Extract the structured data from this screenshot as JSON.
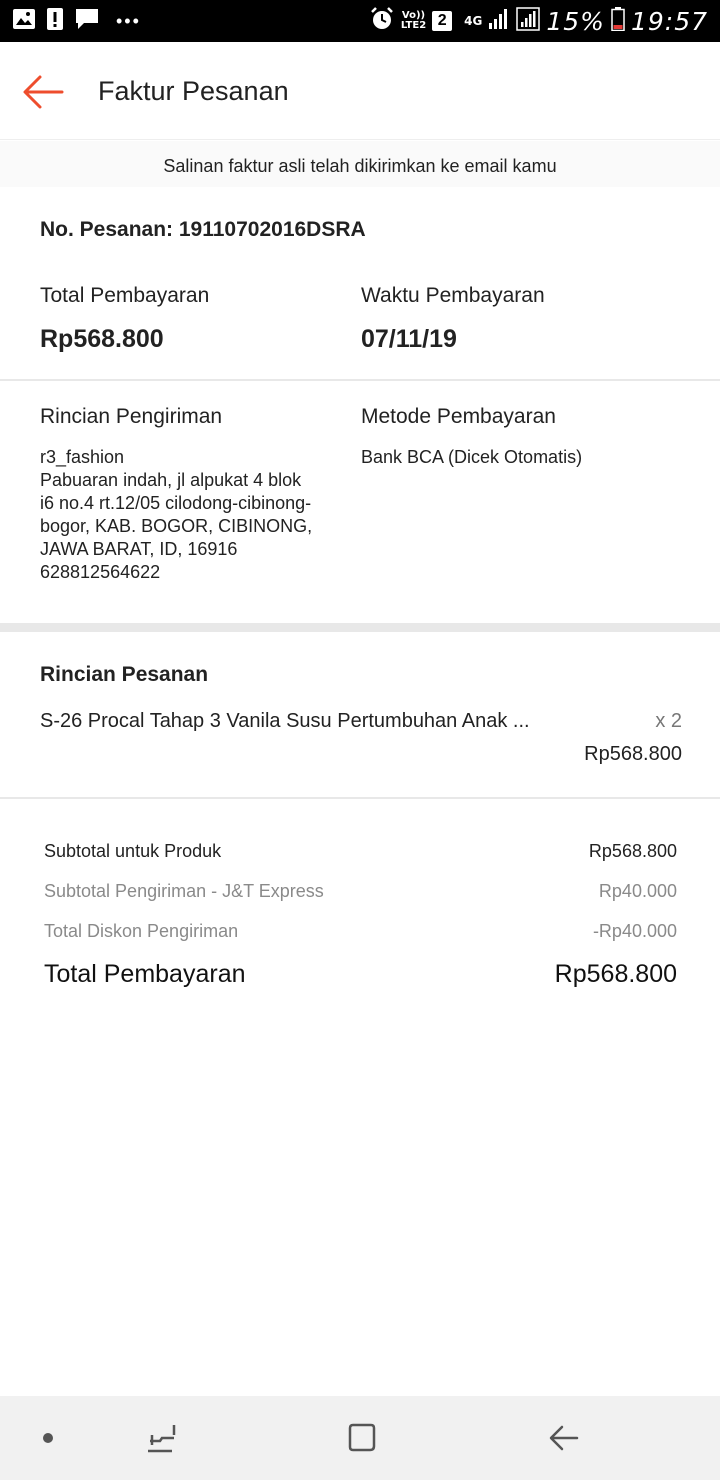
{
  "status_bar": {
    "time": "19:57",
    "battery": "15%",
    "network": "4G",
    "volte": "Vo))",
    "lte": "LTE2",
    "sim": "2",
    "more": "•••"
  },
  "header": {
    "title": "Faktur Pesanan"
  },
  "notice": "Salinan faktur asli telah dikirimkan ke email kamu",
  "order": {
    "number_label": "No. Pesanan: 19110702016DSRA",
    "total_label": "Total Pembayaran",
    "total_value": "Rp568.800",
    "time_label": "Waktu Pembayaran",
    "time_value": "07/11/19"
  },
  "shipping": {
    "label": "Rincian Pengiriman",
    "lines": [
      "r3_fashion",
      "Pabuaran indah, jl alpukat 4 blok",
      "i6 no.4 rt.12/05 cilodong-cibinong-",
      "bogor, KAB. BOGOR, CIBINONG,",
      "JAWA BARAT, ID, 16916",
      "628812564622"
    ]
  },
  "payment_method": {
    "label": "Metode Pembayaran",
    "value": "Bank BCA (Dicek Otomatis)"
  },
  "order_details": {
    "title": "Rincian Pesanan",
    "items": [
      {
        "name": "S-26 Procal Tahap 3 Vanila Susu Pertumbuhan Anak ...",
        "qty": "x 2",
        "price": "Rp568.800"
      }
    ]
  },
  "summary": {
    "rows": [
      {
        "label": "Subtotal untuk Produk",
        "value": "Rp568.800"
      },
      {
        "label": "Subtotal Pengiriman - J&T Express",
        "value": "Rp40.000"
      },
      {
        "label": "Total Diskon Pengiriman",
        "value": "-Rp40.000"
      }
    ],
    "total_label": "Total Pembayaran",
    "total_value": "Rp568.800"
  },
  "colors": {
    "accent": "#ee4d2d",
    "divider": "#e8e8e8",
    "muted_text": "#8a8a8a"
  }
}
